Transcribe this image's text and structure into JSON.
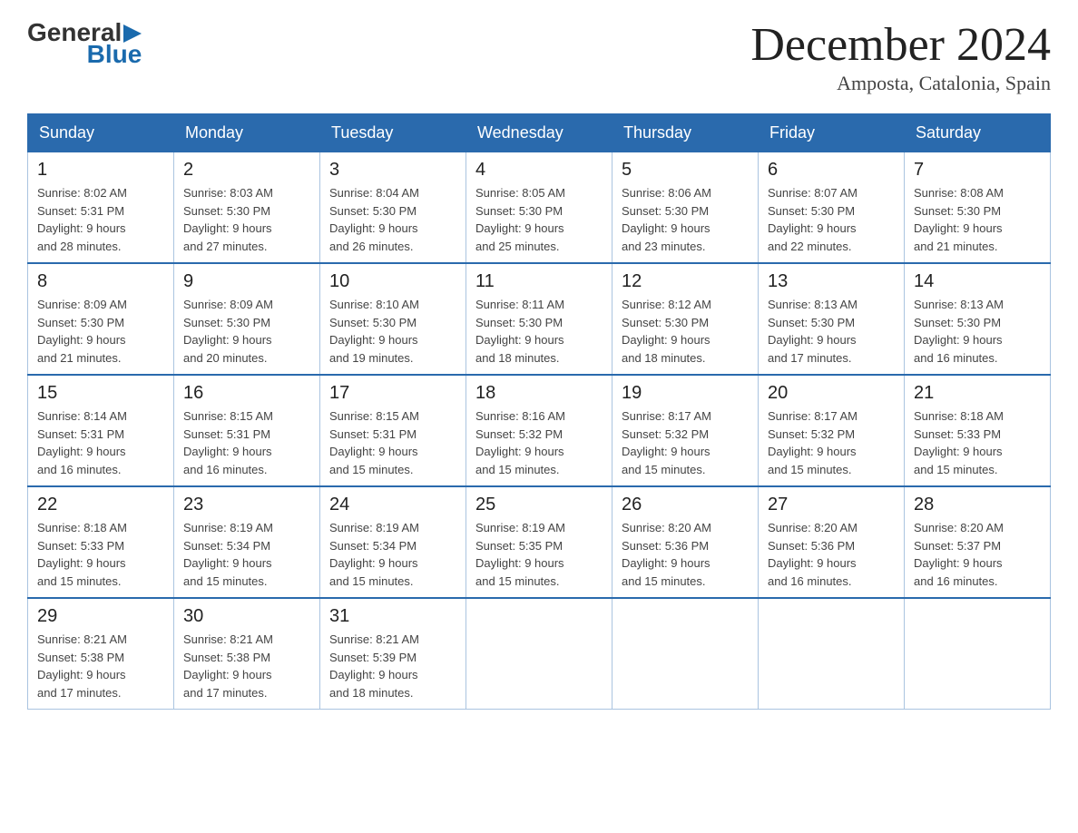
{
  "logo": {
    "general": "General",
    "blue": "Blue"
  },
  "title": {
    "month_year": "December 2024",
    "location": "Amposta, Catalonia, Spain"
  },
  "days_of_week": [
    "Sunday",
    "Monday",
    "Tuesday",
    "Wednesday",
    "Thursday",
    "Friday",
    "Saturday"
  ],
  "weeks": [
    [
      {
        "day": "1",
        "sunrise": "8:02 AM",
        "sunset": "5:31 PM",
        "daylight_hours": "9",
        "daylight_minutes": "28"
      },
      {
        "day": "2",
        "sunrise": "8:03 AM",
        "sunset": "5:30 PM",
        "daylight_hours": "9",
        "daylight_minutes": "27"
      },
      {
        "day": "3",
        "sunrise": "8:04 AM",
        "sunset": "5:30 PM",
        "daylight_hours": "9",
        "daylight_minutes": "26"
      },
      {
        "day": "4",
        "sunrise": "8:05 AM",
        "sunset": "5:30 PM",
        "daylight_hours": "9",
        "daylight_minutes": "25"
      },
      {
        "day": "5",
        "sunrise": "8:06 AM",
        "sunset": "5:30 PM",
        "daylight_hours": "9",
        "daylight_minutes": "23"
      },
      {
        "day": "6",
        "sunrise": "8:07 AM",
        "sunset": "5:30 PM",
        "daylight_hours": "9",
        "daylight_minutes": "22"
      },
      {
        "day": "7",
        "sunrise": "8:08 AM",
        "sunset": "5:30 PM",
        "daylight_hours": "9",
        "daylight_minutes": "21"
      }
    ],
    [
      {
        "day": "8",
        "sunrise": "8:09 AM",
        "sunset": "5:30 PM",
        "daylight_hours": "9",
        "daylight_minutes": "21"
      },
      {
        "day": "9",
        "sunrise": "8:09 AM",
        "sunset": "5:30 PM",
        "daylight_hours": "9",
        "daylight_minutes": "20"
      },
      {
        "day": "10",
        "sunrise": "8:10 AM",
        "sunset": "5:30 PM",
        "daylight_hours": "9",
        "daylight_minutes": "19"
      },
      {
        "day": "11",
        "sunrise": "8:11 AM",
        "sunset": "5:30 PM",
        "daylight_hours": "9",
        "daylight_minutes": "18"
      },
      {
        "day": "12",
        "sunrise": "8:12 AM",
        "sunset": "5:30 PM",
        "daylight_hours": "9",
        "daylight_minutes": "18"
      },
      {
        "day": "13",
        "sunrise": "8:13 AM",
        "sunset": "5:30 PM",
        "daylight_hours": "9",
        "daylight_minutes": "17"
      },
      {
        "day": "14",
        "sunrise": "8:13 AM",
        "sunset": "5:30 PM",
        "daylight_hours": "9",
        "daylight_minutes": "16"
      }
    ],
    [
      {
        "day": "15",
        "sunrise": "8:14 AM",
        "sunset": "5:31 PM",
        "daylight_hours": "9",
        "daylight_minutes": "16"
      },
      {
        "day": "16",
        "sunrise": "8:15 AM",
        "sunset": "5:31 PM",
        "daylight_hours": "9",
        "daylight_minutes": "16"
      },
      {
        "day": "17",
        "sunrise": "8:15 AM",
        "sunset": "5:31 PM",
        "daylight_hours": "9",
        "daylight_minutes": "15"
      },
      {
        "day": "18",
        "sunrise": "8:16 AM",
        "sunset": "5:32 PM",
        "daylight_hours": "9",
        "daylight_minutes": "15"
      },
      {
        "day": "19",
        "sunrise": "8:17 AM",
        "sunset": "5:32 PM",
        "daylight_hours": "9",
        "daylight_minutes": "15"
      },
      {
        "day": "20",
        "sunrise": "8:17 AM",
        "sunset": "5:32 PM",
        "daylight_hours": "9",
        "daylight_minutes": "15"
      },
      {
        "day": "21",
        "sunrise": "8:18 AM",
        "sunset": "5:33 PM",
        "daylight_hours": "9",
        "daylight_minutes": "15"
      }
    ],
    [
      {
        "day": "22",
        "sunrise": "8:18 AM",
        "sunset": "5:33 PM",
        "daylight_hours": "9",
        "daylight_minutes": "15"
      },
      {
        "day": "23",
        "sunrise": "8:19 AM",
        "sunset": "5:34 PM",
        "daylight_hours": "9",
        "daylight_minutes": "15"
      },
      {
        "day": "24",
        "sunrise": "8:19 AM",
        "sunset": "5:34 PM",
        "daylight_hours": "9",
        "daylight_minutes": "15"
      },
      {
        "day": "25",
        "sunrise": "8:19 AM",
        "sunset": "5:35 PM",
        "daylight_hours": "9",
        "daylight_minutes": "15"
      },
      {
        "day": "26",
        "sunrise": "8:20 AM",
        "sunset": "5:36 PM",
        "daylight_hours": "9",
        "daylight_minutes": "15"
      },
      {
        "day": "27",
        "sunrise": "8:20 AM",
        "sunset": "5:36 PM",
        "daylight_hours": "9",
        "daylight_minutes": "16"
      },
      {
        "day": "28",
        "sunrise": "8:20 AM",
        "sunset": "5:37 PM",
        "daylight_hours": "9",
        "daylight_minutes": "16"
      }
    ],
    [
      {
        "day": "29",
        "sunrise": "8:21 AM",
        "sunset": "5:38 PM",
        "daylight_hours": "9",
        "daylight_minutes": "17"
      },
      {
        "day": "30",
        "sunrise": "8:21 AM",
        "sunset": "5:38 PM",
        "daylight_hours": "9",
        "daylight_minutes": "17"
      },
      {
        "day": "31",
        "sunrise": "8:21 AM",
        "sunset": "5:39 PM",
        "daylight_hours": "9",
        "daylight_minutes": "18"
      },
      null,
      null,
      null,
      null
    ]
  ]
}
